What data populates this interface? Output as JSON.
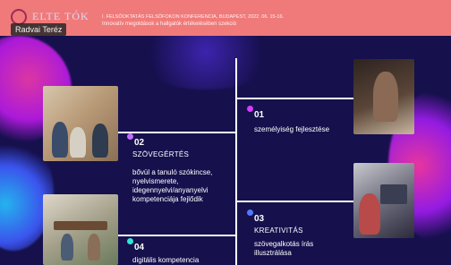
{
  "header": {
    "logo_text": "ELTE TÓK",
    "line1": "I. FELSŐOKTATÁS FELSŐFOKON KONFERENCIA, BUDAPEST, 2022. 06. 15-16.",
    "line2": "Innovatív megoldások a hallgatók értékelésében szekció"
  },
  "presenter": {
    "name": "Radvai Teréz"
  },
  "items": [
    {
      "number": "01",
      "title": "",
      "description": "személyiség fejlesztése",
      "dot_color": "#d83bff"
    },
    {
      "number": "02",
      "title": "SZÖVEGÉRTÉS",
      "description": "bővül a tanuló szókincse, nyelvismerete, idegennyelvi/anyanyelvi kompetenciája fejlődik",
      "dot_color": "#c26bff"
    },
    {
      "number": "03",
      "title": "KREATIVITÁS",
      "description": "szövegalkotás írás illusztrálása",
      "dot_color": "#4e7bff"
    },
    {
      "number": "04",
      "title": "",
      "description": "digitális kompetencia",
      "dot_color": "#2ee6d6"
    }
  ]
}
